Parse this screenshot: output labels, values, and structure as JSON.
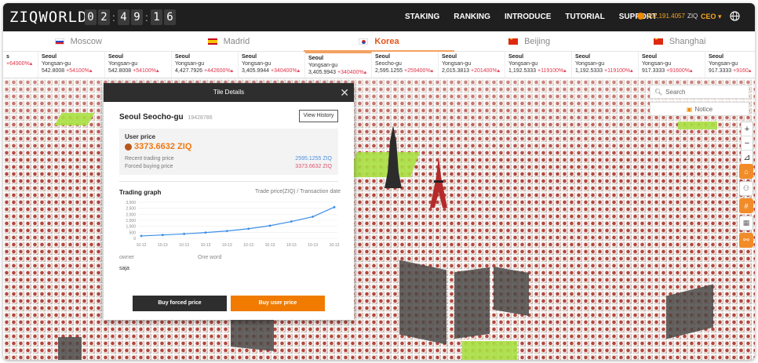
{
  "header": {
    "logo": "ZIQWORLD",
    "clock": [
      "0",
      "2",
      "4",
      "9",
      "1",
      "6"
    ],
    "nav": [
      "STAKING",
      "RANKING",
      "INTRODUCE",
      "TUTORIAL",
      "SUPPORT"
    ],
    "balance": "202,191.4057",
    "balance_unit": "ZIQ",
    "user": "CEO"
  },
  "city_tabs": [
    {
      "label": "Moscow",
      "flag": "ru",
      "active": false
    },
    {
      "label": "Madrid",
      "flag": "es",
      "active": false
    },
    {
      "label": "Korea",
      "flag": "kr",
      "active": true
    },
    {
      "label": "Beijing",
      "flag": "cn",
      "active": false
    },
    {
      "label": "Shanghai",
      "flag": "cn",
      "active": false
    }
  ],
  "ticker": [
    {
      "city": "s",
      "district": "",
      "price": "",
      "change": "+64900%"
    },
    {
      "city": "Seoul",
      "district": "Yongsan-gu",
      "price": "542.8008",
      "change": "+54100%"
    },
    {
      "city": "Seoul",
      "district": "Yongsan-gu",
      "price": "542.8008",
      "change": "+54100%"
    },
    {
      "city": "Seoul",
      "district": "Yongsan-gu",
      "price": "4,427.7926",
      "change": "+442600%"
    },
    {
      "city": "Seoul",
      "district": "Yongsan-gu",
      "price": "3,405.9944",
      "change": "+340400%"
    },
    {
      "city": "Seoul",
      "district": "Yongsan-gu",
      "price": "3,405.9943",
      "change": "+340400%"
    },
    {
      "city": "Seoul",
      "district": "Seocho-gu",
      "price": "2,595.1255",
      "change": "+259400%"
    },
    {
      "city": "Seoul",
      "district": "Yongsan-gu",
      "price": "2,015.3813",
      "change": "+201400%"
    },
    {
      "city": "Seoul",
      "district": "Yongsan-gu",
      "price": "1,192.5333",
      "change": "+119100%"
    },
    {
      "city": "Seoul",
      "district": "Yongsan-gu",
      "price": "1,192.5333",
      "change": "+119100%"
    },
    {
      "city": "Seoul",
      "district": "Yongsan-gu",
      "price": "917.3333",
      "change": "+91600%"
    },
    {
      "city": "Seoul",
      "district": "Yongsan-gu",
      "price": "917.3333",
      "change": "+9160"
    }
  ],
  "map_controls": {
    "search_placeholder": "Search",
    "notice": "Notice",
    "zoom_in": "+",
    "zoom_out": "−",
    "compass": "⊿"
  },
  "modal": {
    "header": "Tile Details",
    "title": "Seoul Seocho-gu",
    "tile_id": "19428786",
    "view_history": "View History",
    "user_price_label": "User price",
    "user_price": "3373.6632 ZIQ",
    "recent_label": "Recent trading price",
    "recent_value": "2595.1255 ZIQ",
    "forced_label": "Forced buying price",
    "forced_value": "3373.6632 ZIQ",
    "graph_label": "Trading graph",
    "graph_legend": "Trade price(ZIQ) / Transaction date",
    "owner_label": "owner",
    "one_word_label": "One word",
    "owner_value": "saja",
    "buy_forced": "Buy forced price",
    "buy_user": "Buy user price"
  },
  "colors": {
    "accent": "#f07b00",
    "topbar": "#1f1f1f",
    "line": "#3a8ee6",
    "recent": "#4a90e2",
    "forced": "#e05070"
  },
  "chart_data": {
    "type": "line",
    "categories": [
      "10-12",
      "10-13",
      "10-13",
      "10-13",
      "10-13",
      "10-13",
      "10-13",
      "10-13",
      "10-13"
    ],
    "values": [
      200,
      280,
      370,
      480,
      610,
      800,
      1050,
      1400,
      1800,
      2595
    ],
    "x": [
      "10-12",
      "10-13",
      "10-13",
      "10-13",
      "10-13",
      "10-13",
      "10-13",
      "10-13",
      "10-13",
      "10-13"
    ],
    "yticks": [
      "3,000",
      "2,500",
      "2,000",
      "1,500",
      "1,000",
      "500",
      "0"
    ],
    "ylim": [
      0,
      3000
    ],
    "grid": true
  }
}
